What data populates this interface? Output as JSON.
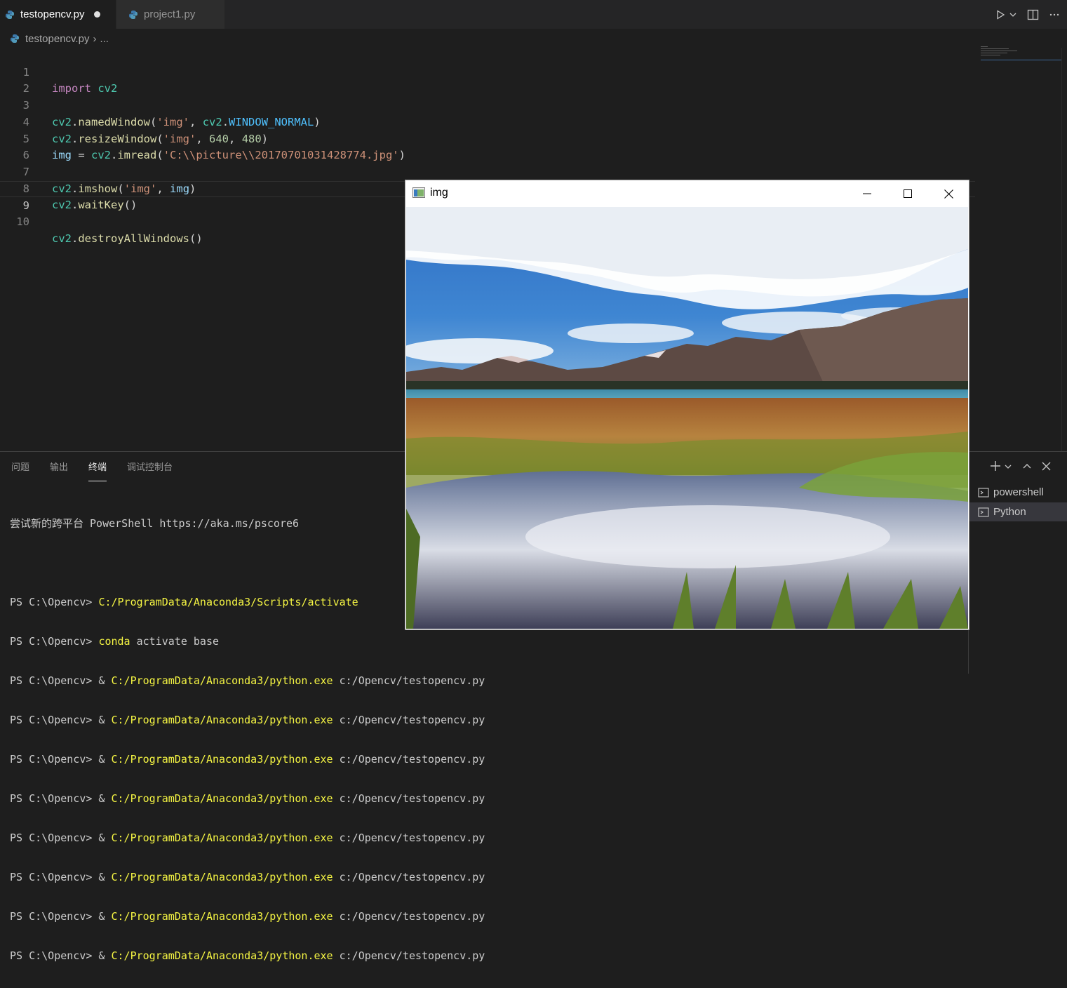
{
  "tabs": [
    {
      "label": "testopencv.py",
      "active": true,
      "dirty": true
    },
    {
      "label": "project1.py",
      "active": false
    }
  ],
  "breadcrumb": {
    "file": "testopencv.py",
    "sep": "›",
    "rest": "..."
  },
  "editor": {
    "line_numbers": [
      "1",
      "2",
      "3",
      "4",
      "5",
      "6",
      "7",
      "8",
      "9",
      "10"
    ],
    "current_line": 9
  },
  "panel": {
    "tabs": [
      "问题",
      "输出",
      "终端",
      "调试控制台"
    ],
    "active_tab": "终端",
    "terminal_lines": [
      {
        "plain": "尝试新的跨平台 PowerShell https://aka.ms/pscore6"
      },
      {
        "plain": ""
      },
      {
        "prompt": "PS C:\\Opencv> ",
        "cmd": "C:/ProgramData/Anaconda3/Scripts/activate",
        "arg": ""
      },
      {
        "prompt": "PS C:\\Opencv> ",
        "cmd": "conda",
        "arg": " activate base"
      },
      {
        "prompt": "PS C:\\Opencv> & ",
        "cmd": "C:/ProgramData/Anaconda3/python.exe",
        "arg": " c:/Opencv/testopencv.py"
      },
      {
        "prompt": "PS C:\\Opencv> & ",
        "cmd": "C:/ProgramData/Anaconda3/python.exe",
        "arg": " c:/Opencv/testopencv.py"
      },
      {
        "prompt": "PS C:\\Opencv> & ",
        "cmd": "C:/ProgramData/Anaconda3/python.exe",
        "arg": " c:/Opencv/testopencv.py"
      },
      {
        "prompt": "PS C:\\Opencv> & ",
        "cmd": "C:/ProgramData/Anaconda3/python.exe",
        "arg": " c:/Opencv/testopencv.py"
      },
      {
        "prompt": "PS C:\\Opencv> & ",
        "cmd": "C:/ProgramData/Anaconda3/python.exe",
        "arg": " c:/Opencv/testopencv.py"
      },
      {
        "prompt": "PS C:\\Opencv> & ",
        "cmd": "C:/ProgramData/Anaconda3/python.exe",
        "arg": " c:/Opencv/testopencv.py"
      },
      {
        "prompt": "PS C:\\Opencv> & ",
        "cmd": "C:/ProgramData/Anaconda3/python.exe",
        "arg": " c:/Opencv/testopencv.py"
      },
      {
        "prompt": "PS C:\\Opencv> & ",
        "cmd": "C:/ProgramData/Anaconda3/python.exe",
        "arg": " c:/Opencv/testopencv.py"
      }
    ],
    "terminals": [
      {
        "label": "powershell",
        "selected": false
      },
      {
        "label": "Python",
        "selected": true
      }
    ]
  },
  "cv_window": {
    "title": "img"
  },
  "icons": {
    "run": "run-icon",
    "run_dropdown": "chevron-down-icon",
    "split": "split-editor-icon",
    "more": "ellipsis-icon",
    "new_terminal": "plus-icon",
    "maximize_panel": "chevron-up-icon",
    "close_panel": "close-icon",
    "minimize": "minimize-icon",
    "maximize": "maximize-icon",
    "close": "close-icon"
  },
  "colors": {
    "editor_bg": "#1e1e1e",
    "tabbar_bg": "#252526",
    "keyword": "#c586c0",
    "string": "#ce9178",
    "function": "#dcdcaa",
    "terminal_cmd": "#f5f543"
  }
}
